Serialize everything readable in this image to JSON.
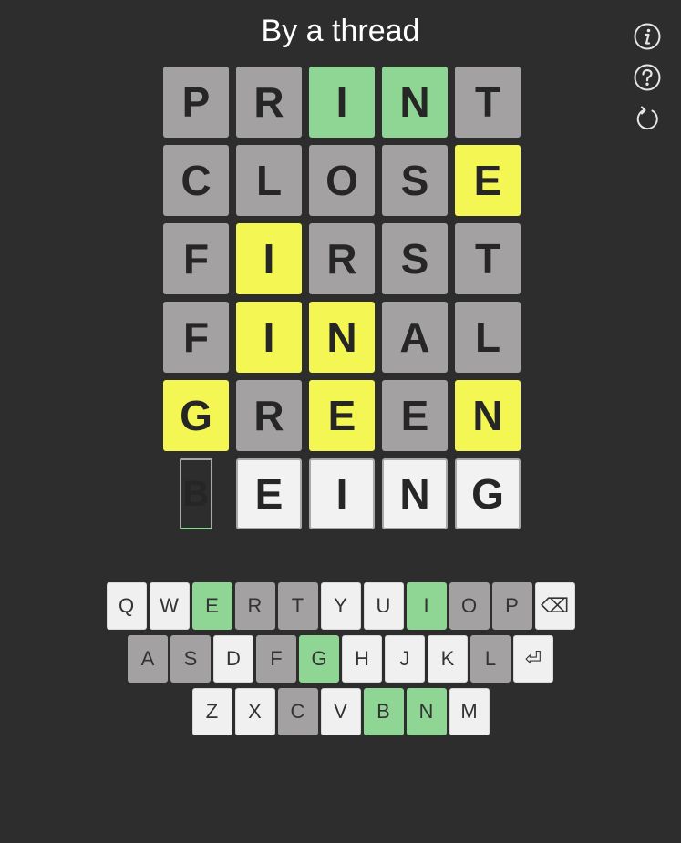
{
  "title": "By a thread",
  "icons": [
    "info-icon",
    "help-icon",
    "restart-icon"
  ],
  "colors": {
    "background": "#2d2d2d",
    "absent": "#a3a1a2",
    "correct": "#8fd694",
    "present": "#f3f653",
    "empty": "#f2f2f2"
  },
  "board": [
    [
      {
        "letter": "P",
        "state": "gray"
      },
      {
        "letter": "R",
        "state": "gray"
      },
      {
        "letter": "I",
        "state": "green"
      },
      {
        "letter": "N",
        "state": "green"
      },
      {
        "letter": "T",
        "state": "gray"
      }
    ],
    [
      {
        "letter": "C",
        "state": "gray"
      },
      {
        "letter": "L",
        "state": "gray"
      },
      {
        "letter": "O",
        "state": "gray"
      },
      {
        "letter": "S",
        "state": "gray"
      },
      {
        "letter": "E",
        "state": "yellow"
      }
    ],
    [
      {
        "letter": "F",
        "state": "gray"
      },
      {
        "letter": "I",
        "state": "yellow"
      },
      {
        "letter": "R",
        "state": "gray"
      },
      {
        "letter": "S",
        "state": "gray"
      },
      {
        "letter": "T",
        "state": "gray"
      }
    ],
    [
      {
        "letter": "F",
        "state": "gray"
      },
      {
        "letter": "I",
        "state": "yellow"
      },
      {
        "letter": "N",
        "state": "yellow"
      },
      {
        "letter": "A",
        "state": "gray"
      },
      {
        "letter": "L",
        "state": "gray"
      }
    ],
    [
      {
        "letter": "G",
        "state": "yellow"
      },
      {
        "letter": "R",
        "state": "gray"
      },
      {
        "letter": "E",
        "state": "yellow"
      },
      {
        "letter": "E",
        "state": "gray"
      },
      {
        "letter": "N",
        "state": "yellow"
      }
    ],
    [
      {
        "letter": "B",
        "state": "cursor"
      },
      {
        "letter": "E",
        "state": "input"
      },
      {
        "letter": "I",
        "state": "input"
      },
      {
        "letter": "N",
        "state": "input"
      },
      {
        "letter": "G",
        "state": "input"
      }
    ]
  ],
  "keyboard": [
    [
      {
        "label": "Q",
        "state": "white"
      },
      {
        "label": "W",
        "state": "white"
      },
      {
        "label": "E",
        "state": "green"
      },
      {
        "label": "R",
        "state": "gray"
      },
      {
        "label": "T",
        "state": "gray"
      },
      {
        "label": "Y",
        "state": "white"
      },
      {
        "label": "U",
        "state": "white"
      },
      {
        "label": "I",
        "state": "green"
      },
      {
        "label": "O",
        "state": "gray"
      },
      {
        "label": "P",
        "state": "gray"
      },
      {
        "label": "⌫",
        "state": "white",
        "name": "backspace-key"
      }
    ],
    [
      {
        "label": "A",
        "state": "gray"
      },
      {
        "label": "S",
        "state": "gray"
      },
      {
        "label": "D",
        "state": "white"
      },
      {
        "label": "F",
        "state": "gray"
      },
      {
        "label": "G",
        "state": "green"
      },
      {
        "label": "H",
        "state": "white"
      },
      {
        "label": "J",
        "state": "white"
      },
      {
        "label": "K",
        "state": "white"
      },
      {
        "label": "L",
        "state": "gray"
      },
      {
        "label": "⏎",
        "state": "white",
        "name": "enter-key"
      }
    ],
    [
      {
        "label": "Z",
        "state": "white"
      },
      {
        "label": "X",
        "state": "white"
      },
      {
        "label": "C",
        "state": "gray"
      },
      {
        "label": "V",
        "state": "white"
      },
      {
        "label": "B",
        "state": "green"
      },
      {
        "label": "N",
        "state": "green"
      },
      {
        "label": "M",
        "state": "white"
      }
    ]
  ]
}
